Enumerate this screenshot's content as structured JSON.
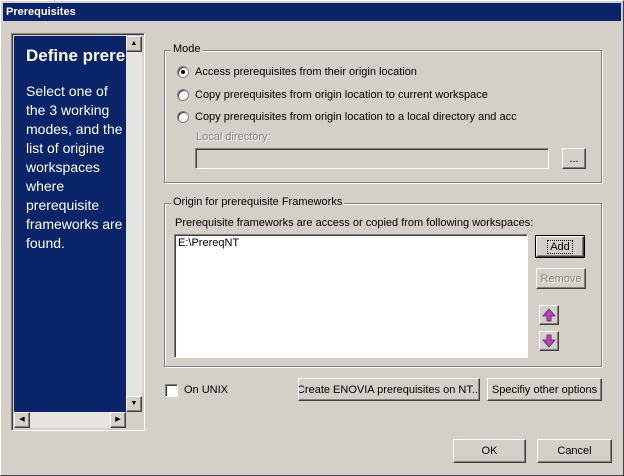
{
  "window": {
    "title": "Prerequisites"
  },
  "help": {
    "title": "Define prerequisites",
    "body": "Select one of the 3 working modes, and the list of origine workspaces where prerequisite frameworks are found."
  },
  "mode": {
    "legend": "Mode",
    "options": [
      "Access prerequisites from their origin location",
      "Copy prerequisites from origin location to current workspace",
      "Copy prerequisites from origin location to a local directory and acc"
    ],
    "selected_index": 0,
    "local_dir_label": "Local directory:",
    "local_dir_value": "",
    "browse_label": "..."
  },
  "origin": {
    "legend": "Origin for prerequisite Frameworks",
    "description": "Prerequisite frameworks are access or copied from following workspaces:",
    "items": [
      "E:\\PrereqNT"
    ],
    "add_label": "Add",
    "remove_label": "Remove"
  },
  "footer": {
    "unix_label": "On UNIX",
    "unix_checked": false,
    "create_label": "Create ENOVIA prerequisites on NT...",
    "other_label": "Specifiy other options",
    "ok_label": "OK",
    "cancel_label": "Cancel"
  },
  "colors": {
    "titlebar": "#0a246a",
    "face": "#d4d0c8",
    "help_bg": "#0a246a",
    "arrow": "#c040c0"
  }
}
